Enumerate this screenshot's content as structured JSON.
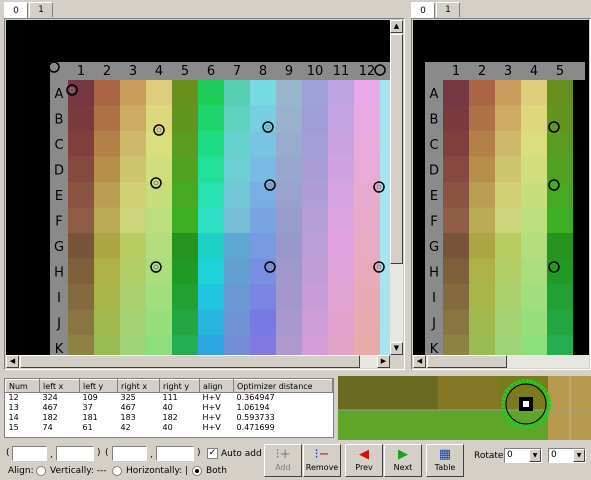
{
  "left_pane": {
    "tabs": [
      "0",
      "1"
    ],
    "active_tab": 0
  },
  "right_pane": {
    "tabs": [
      "0",
      "1"
    ],
    "active_tab": 0
  },
  "grid": {
    "columns": [
      "1",
      "2",
      "3",
      "4",
      "5",
      "6",
      "7",
      "8",
      "9",
      "10",
      "11",
      "12"
    ],
    "rows": [
      "A",
      "B",
      "C",
      "D",
      "E",
      "F",
      "G",
      "H",
      "I",
      "J",
      "K"
    ]
  },
  "points_table": {
    "headers": [
      "Num",
      "left x",
      "left y",
      "right x",
      "right y",
      "align",
      "Optimizer distance"
    ],
    "rows": [
      [
        "12",
        "324",
        "109",
        "325",
        "111",
        "H+V",
        "0.364947"
      ],
      [
        "13",
        "467",
        "37",
        "467",
        "40",
        "H+V",
        "1.06194"
      ],
      [
        "14",
        "182",
        "181",
        "183",
        "182",
        "H+V",
        "0.593733"
      ],
      [
        "15",
        "74",
        "61",
        "42",
        "40",
        "H+V",
        "0.471699"
      ]
    ]
  },
  "controls": {
    "open_paren_1": "(",
    "sep_1": ",",
    "close_paren_1": ")",
    "open_paren_2": "(",
    "sep_2": ",",
    "close_paren_2": ")",
    "auto_add_label": "Auto add",
    "auto_add_checked": "✓",
    "align_label": "Align:",
    "vertically_label": "Vertically: ---",
    "horizontally_label": "Horizontally: |",
    "both_label": "Both",
    "add_label": "Add",
    "remove_label": "Remove",
    "prev_label": "Prev",
    "next_label": "Next",
    "table_label": "Table",
    "rotate_label": "Rotate:",
    "rotate_left_value": "0",
    "rotate_right_value": "0"
  },
  "colors": {
    "chart_background": "#000000",
    "ruler": "#8a8a8a",
    "marker_green": "#22cc22"
  }
}
